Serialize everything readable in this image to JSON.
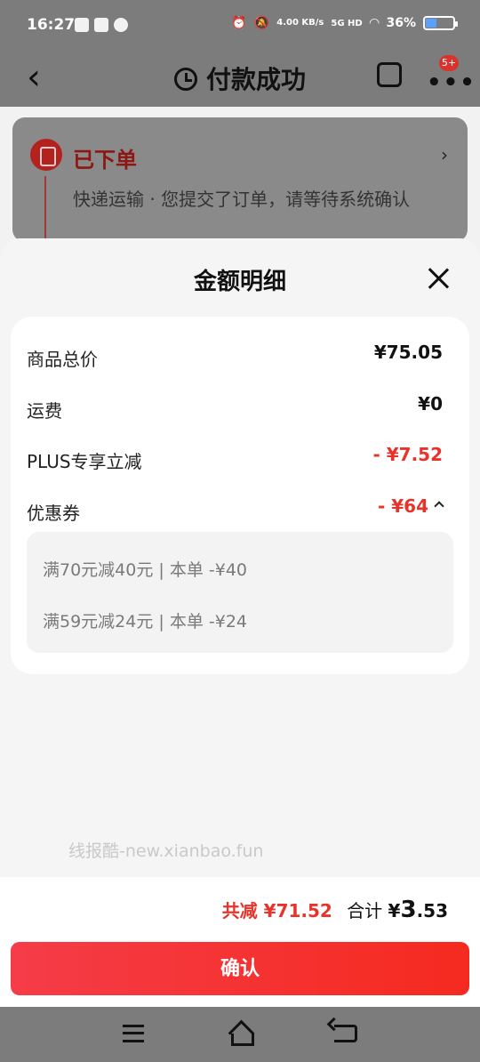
{
  "status_bar": {
    "time": "16:27",
    "network_speed": "4.00 KB/s",
    "signal": "5G HD",
    "battery": "36%"
  },
  "header": {
    "title": "付款成功",
    "badge": "5+"
  },
  "order_card": {
    "status": "已下单",
    "description": "快递运输 · 您提交了订单，请等待系统确认"
  },
  "sheet": {
    "title": "金额明细",
    "rows": [
      {
        "label": "商品总价",
        "value": "¥75.05"
      },
      {
        "label": "运费",
        "value": "¥0"
      },
      {
        "label": "PLUS专享立减",
        "value": "- ¥7.52"
      },
      {
        "label": "优惠券",
        "value": "- ¥64"
      }
    ],
    "coupons": [
      "满70元减40元 | 本单 -¥40",
      "满59元减24元 | 本单 -¥24"
    ]
  },
  "watermark": "线报酷-new.xianbao.fun",
  "footer": {
    "saved": "共减 ¥71.52",
    "total_label": "合计",
    "total_currency": "¥",
    "total_int": "3",
    "total_dec": ".53",
    "confirm_label": "确认"
  },
  "colors": {
    "accent": "#e8332a",
    "button_start": "#f53c48",
    "button_end": "#f52a1f"
  }
}
